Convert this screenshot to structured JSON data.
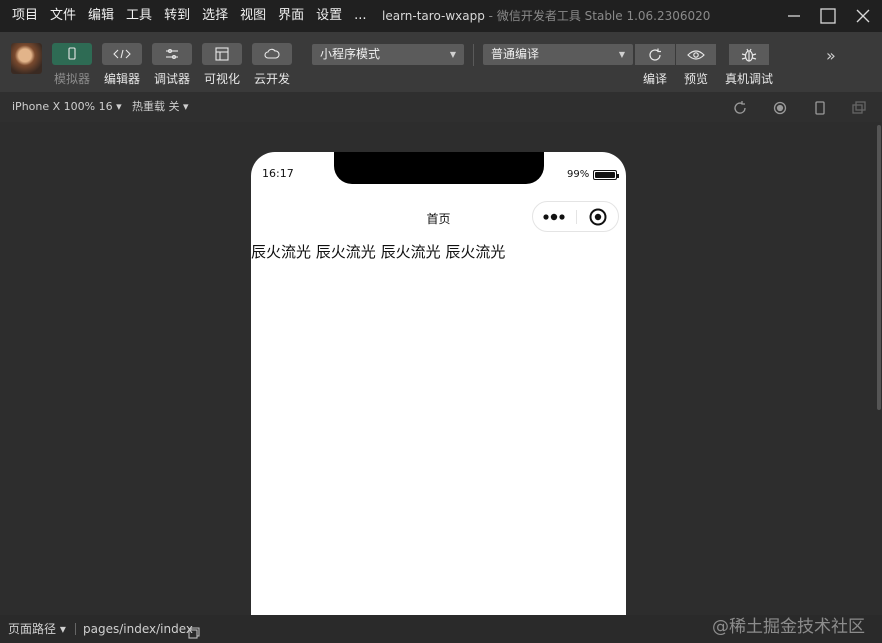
{
  "menu": {
    "items": [
      "项目",
      "文件",
      "编辑",
      "工具",
      "转到",
      "选择",
      "视图",
      "界面",
      "设置",
      "..."
    ]
  },
  "window": {
    "project": "learn-taro-wxapp",
    "separator": " - ",
    "tool": "微信开发者工具 Stable 1.06.2306020",
    "controls": [
      "minimize-icon",
      "maximize-icon",
      "close-icon"
    ]
  },
  "toolbar": {
    "buttons": [
      {
        "label": "模拟器",
        "icon": "phone-icon",
        "active": true
      },
      {
        "label": "编辑器",
        "icon": "code-icon",
        "active": false
      },
      {
        "label": "调试器",
        "icon": "sliders-icon",
        "active": false
      },
      {
        "label": "可视化",
        "icon": "layout-icon",
        "active": false
      },
      {
        "label": "云开发",
        "icon": "cloud-icon",
        "active": false
      }
    ],
    "mode_select": "小程序模式",
    "compile_select": "普通编译",
    "actions": [
      {
        "label": "编译",
        "icon": "refresh-icon"
      },
      {
        "label": "预览",
        "icon": "eye-icon"
      },
      {
        "label": "真机调试",
        "icon": "bug-icon"
      }
    ],
    "more_icon": "double-chevron-right-icon"
  },
  "simbar": {
    "device": "iPhone X 100% 16",
    "hot_reload": "热重载 关",
    "caret": "▾",
    "icons": [
      "rotate-icon",
      "record-icon",
      "device-icon",
      "popout-icon"
    ]
  },
  "phone": {
    "time": "16:17",
    "battery_text": "99%",
    "battery_level": 0.99,
    "nav_title": "首页",
    "capsule_icons": [
      "more-dots-icon",
      "close-target-icon"
    ],
    "content": [
      "辰火流光",
      "辰火流光",
      "辰火流光",
      "辰火流光"
    ]
  },
  "bottom": {
    "page_path_label": "页面路径",
    "caret": "▾",
    "path": "pages/index/index",
    "copy_icon": "copy-icon"
  },
  "watermark": "@稀土掘金技术社区"
}
